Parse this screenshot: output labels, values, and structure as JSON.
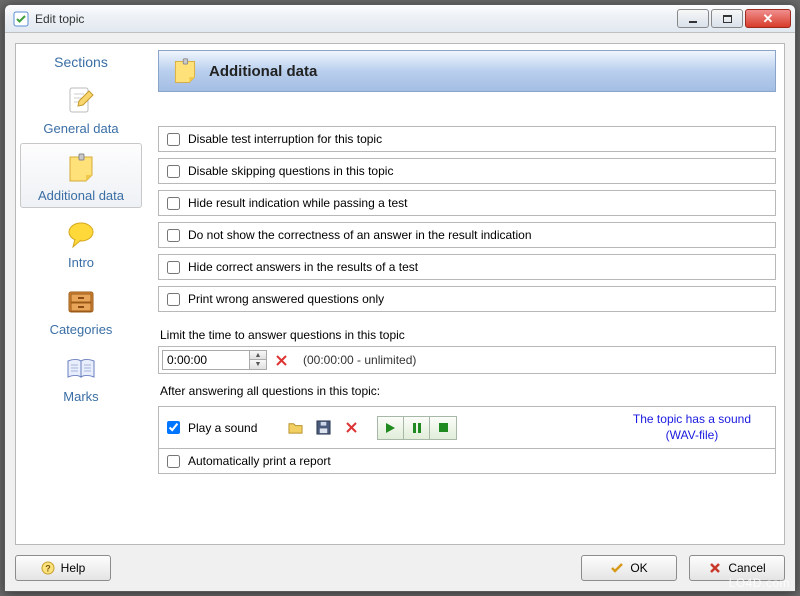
{
  "window": {
    "title": "Edit topic"
  },
  "sidebar": {
    "title": "Sections",
    "items": [
      {
        "label": "General data"
      },
      {
        "label": "Additional data"
      },
      {
        "label": "Intro"
      },
      {
        "label": "Categories"
      },
      {
        "label": "Marks"
      }
    ]
  },
  "header": {
    "title": "Additional data"
  },
  "options": {
    "disable_interruption": {
      "label": "Disable test interruption for this topic",
      "checked": false
    },
    "disable_skipping": {
      "label": "Disable skipping questions in this topic",
      "checked": false
    },
    "hide_result_indication": {
      "label": "Hide result indication while passing a test",
      "checked": false
    },
    "hide_correctness": {
      "label": "Do not show the correctness of an answer in the result indication",
      "checked": false
    },
    "hide_correct_answers": {
      "label": "Hide correct answers in the results of a test",
      "checked": false
    },
    "print_wrong_only": {
      "label": "Print wrong answered questions only",
      "checked": false
    }
  },
  "time": {
    "label": "Limit the time to answer questions in this topic",
    "value": "0:00:00",
    "hint": "(00:00:00 - unlimited)"
  },
  "after": {
    "label": "After answering all questions in this topic:",
    "play_sound": {
      "label": "Play a sound",
      "checked": true
    },
    "sound_msg_line1": "The topic has a sound",
    "sound_msg_line2": "(WAV-file)",
    "auto_print": {
      "label": "Automatically print a report",
      "checked": false
    }
  },
  "buttons": {
    "help": "Help",
    "ok": "OK",
    "cancel": "Cancel"
  },
  "watermark": "LO4D.com"
}
